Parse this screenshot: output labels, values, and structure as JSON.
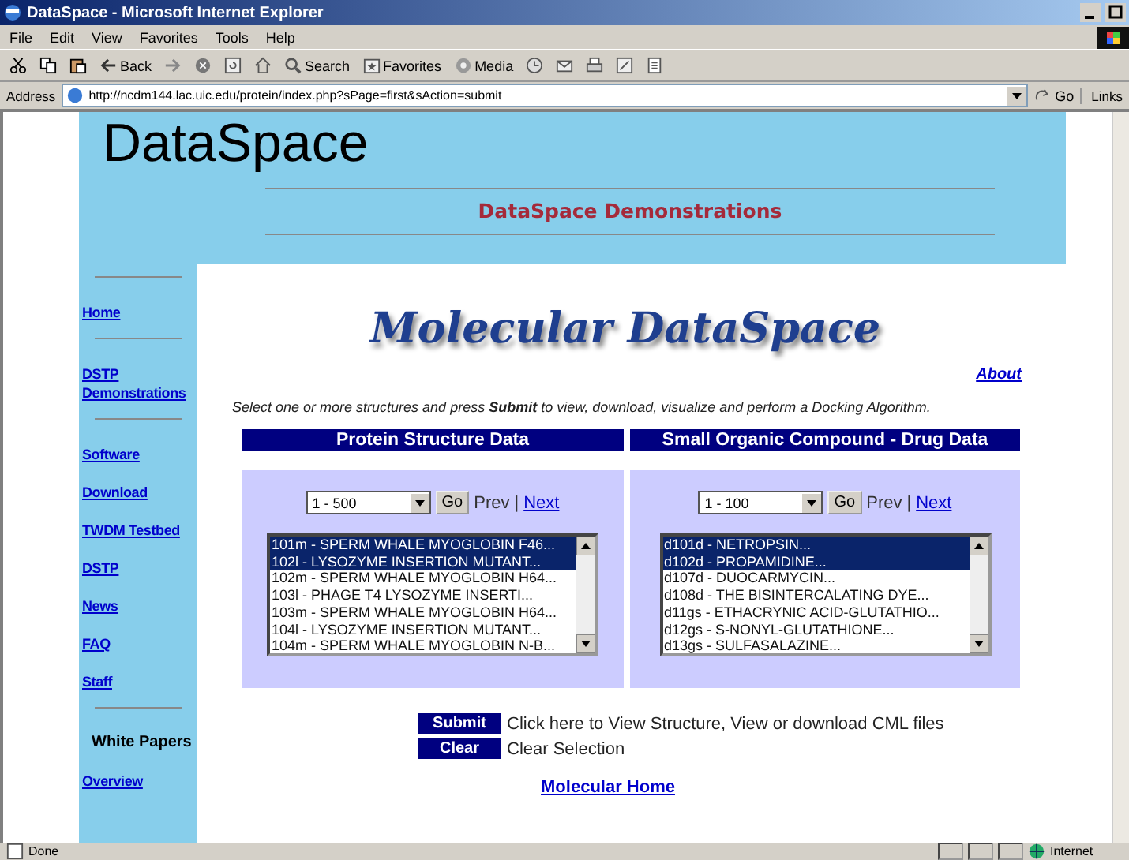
{
  "window": {
    "title": "DataSpace - Microsoft Internet Explorer"
  },
  "menu": [
    "File",
    "Edit",
    "View",
    "Favorites",
    "Tools",
    "Help"
  ],
  "toolbar": {
    "back": "Back",
    "search": "Search",
    "favorites": "Favorites",
    "media": "Media"
  },
  "address": {
    "label": "Address",
    "url": "http://ncdm144.lac.uic.edu/protein/index.php?sPage=first&sAction=submit",
    "go": "Go",
    "links": "Links"
  },
  "header": {
    "logo": "DataSpace",
    "subtitle": "DataSpace Demonstrations"
  },
  "sidebar": [
    {
      "kind": "divider"
    },
    {
      "kind": "link",
      "label": "Home"
    },
    {
      "kind": "divider"
    },
    {
      "kind": "link",
      "label": "DSTP Demonstrations"
    },
    {
      "kind": "divider"
    },
    {
      "kind": "link",
      "label": "Software"
    },
    {
      "kind": "link",
      "label": "Download"
    },
    {
      "kind": "link",
      "label": "TWDM Testbed"
    },
    {
      "kind": "link",
      "label": "DSTP"
    },
    {
      "kind": "link",
      "label": "News"
    },
    {
      "kind": "link",
      "label": "FAQ"
    },
    {
      "kind": "link",
      "label": "Staff"
    },
    {
      "kind": "divider"
    },
    {
      "kind": "heading",
      "label": "White Papers"
    },
    {
      "kind": "link",
      "label": "Overview"
    }
  ],
  "main": {
    "title": "Molecular DataSpace",
    "about": "About",
    "instruction": "Select one or more structures and press **Submit** to view, download, visualize and perform a Docking Algorithm."
  },
  "panels": [
    {
      "heading": "Protein Structure Data",
      "range": "1 - 500",
      "go": "Go",
      "prev": "Prev",
      "separator": "|",
      "next": "Next",
      "items": [
        {
          "label": "101m - SPERM WHALE MYOGLOBIN F46...",
          "selected": true
        },
        {
          "label": "102l - LYSOZYME INSERTION MUTANT...",
          "selected": true
        },
        {
          "label": "102m - SPERM WHALE MYOGLOBIN H64...",
          "selected": false
        },
        {
          "label": "103l - PHAGE T4 LYSOZYME INSERTI...",
          "selected": false
        },
        {
          "label": "103m - SPERM WHALE MYOGLOBIN H64...",
          "selected": false
        },
        {
          "label": "104l - LYSOZYME INSERTION MUTANT...",
          "selected": false
        },
        {
          "label": "104m - SPERM WHALE MYOGLOBIN N-B...",
          "selected": false
        }
      ]
    },
    {
      "heading": "Small Organic Compound - Drug Data",
      "range": "1 - 100",
      "go": "Go",
      "prev": "Prev",
      "separator": "|",
      "next": "Next",
      "items": [
        {
          "label": "d101d - NETROPSIN...",
          "selected": true
        },
        {
          "label": "d102d - PROPAMIDINE...",
          "selected": true
        },
        {
          "label": "d107d - DUOCARMYCIN...",
          "selected": false
        },
        {
          "label": "d108d - THE BISINTERCALATING DYE...",
          "selected": false
        },
        {
          "label": "d11gs - ETHACRYNIC ACID-GLUTATHIO...",
          "selected": false
        },
        {
          "label": "d12gs - S-NONYL-GLUTATHIONE...",
          "selected": false
        },
        {
          "label": "d13gs - SULFASALAZINE...",
          "selected": false
        }
      ]
    }
  ],
  "actions": [
    {
      "button": "Submit",
      "description": "Click here to View Structure, View or download CML files"
    },
    {
      "button": "Clear",
      "description": "Clear Selection"
    }
  ],
  "home_link": "Molecular Home",
  "status_bar": {
    "text": "Done",
    "zone": "Internet"
  }
}
